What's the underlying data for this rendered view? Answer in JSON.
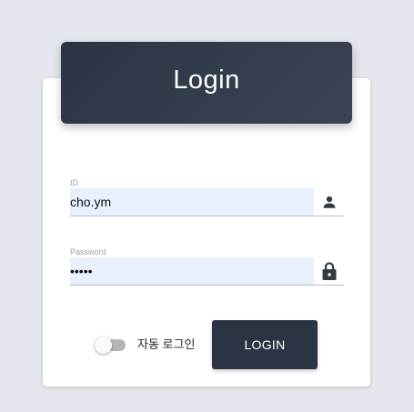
{
  "login": {
    "title": "Login",
    "id_field": {
      "label": "ID",
      "value": "cho.ym",
      "icon": "person-icon"
    },
    "password_field": {
      "label": "Password",
      "value": "•••••",
      "icon": "lock-icon"
    },
    "auto_login": {
      "label": "자동 로그인",
      "enabled": false
    },
    "submit_label": "LOGIN"
  },
  "colors": {
    "background": "#e4e8ee",
    "header": "#2b3442",
    "button": "#2b3442",
    "input_fill": "#e8f0fe",
    "icon": "#333a44"
  }
}
